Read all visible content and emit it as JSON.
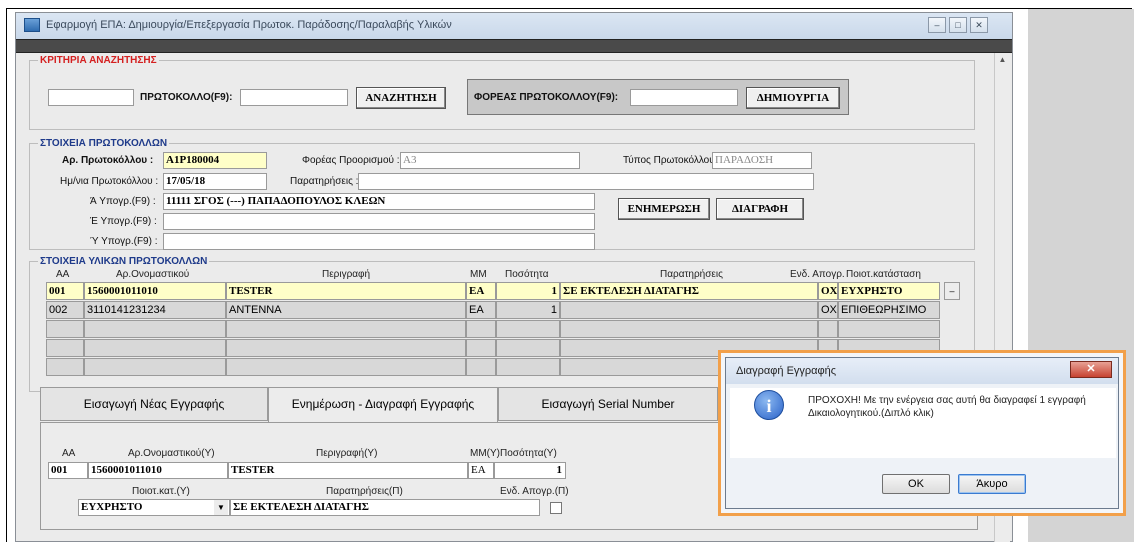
{
  "window": {
    "title": "Εφαρμογή ΕΠΑ: Δημιουργία/Επεξεργασία Πρωτοκ. Παράδοσης/Παραλαβής Υλικών",
    "min_icon": "minimize-icon",
    "max_icon": "maximize-icon",
    "close_icon": "close-icon"
  },
  "search": {
    "legend": "ΚΡΙΤΗΡΙΑ ΑΝΑΖΗΤΗΣΗΣ",
    "protocol_label": "ΠΡΩΤΟΚΟΛΛΟ(F9):",
    "search_button": "ΑΝΑΖΗΤΗΣΗ",
    "foreas_label": "ΦΟΡΕΑΣ ΠΡΩΤΟΚΟΛΛΟΥ(F9):",
    "create_button": "ΔΗΜΙΟΥΡΓΙΑ"
  },
  "protocol": {
    "legend": "ΣΤΟΙΧΕΙΑ ΠΡΩΤΟΚΟΛΛΩΝ",
    "ar_label": "Αρ. Πρωτοκόλλου :",
    "ar_value": "Α1Ρ180004",
    "foreas_label": "Φορέας Προορισμού :",
    "foreas_value": "Α3",
    "typos_label": "Τύπος Πρωτοκόλλου:",
    "typos_value": "ΠΑΡΑΔΟΣΗ",
    "date_label": "Ημ/νια Πρωτοκόλλου :",
    "date_value": "17/05/18",
    "notes_label": "Παρατηρήσεις :",
    "notes_value": "",
    "a_label": "Ά Υπογρ.(F9) :",
    "a_value": "11111 ΣΓΟΣ (---) ΠΑΠΑΔΟΠΟΥΛΟΣ ΚΛΕΩΝ",
    "b_label": "Έ Υπογρ.(F9) :",
    "b_value": "",
    "c_label": "Ύ Υπογρ.(F9) :",
    "c_value": "",
    "update_button": "ΕΝΗΜΕΡΩΣΗ",
    "delete_button": "ΔΙΑΓΡΑΦΗ"
  },
  "items": {
    "legend": "ΣΤΟΙΧΕΙΑ ΥΛΙΚΩΝ ΠΡΩΤΟΚΟΛΛΩΝ",
    "headers": [
      "ΑΑ",
      "Αρ.Ονομαστικού",
      "Περιγραφή",
      "ΜΜ",
      "Ποσότητα",
      "Παρατηρήσεις",
      "Ενδ. Απογρ.",
      "Ποιοτ.κατάσταση"
    ],
    "rows": [
      [
        "001",
        "1560001011010",
        "TESTER",
        "ΕΑ",
        "1",
        "ΣΕ ΕΚΤΕΛΕΣΗ ΔΙΑΤΑΓΗΣ",
        "ΟΧ",
        "ΕΥΧΡΗΣΤΟ"
      ],
      [
        "002",
        "3110141231234",
        "ANTENNA",
        "ΕΑ",
        "1",
        "",
        "ΟΧΙ",
        "ΕΠΙΘΕΩΡΗΣΙΜΟ"
      ]
    ]
  },
  "tabs": [
    "Εισαγωγή Νέας Εγγραφής",
    "Ενημέρωση - Διαγραφή Εγγραφής",
    "Εισαγωγή Serial Number"
  ],
  "detail": {
    "headers": [
      "ΑΑ",
      "Αρ.Ονομαστικού(Υ)",
      "Περιγραφή(Υ)",
      "ΜΜ(Υ)",
      "Ποσότητα(Υ)"
    ],
    "aa": "001",
    "onomastikou": "1560001011010",
    "perigrafi": "TESTER",
    "mm": "ΕΑ",
    "posotita": "1",
    "poiot_label": "Ποιοτ.κατ.(Υ)",
    "notes_label": "Παρατηρήσεις(Π)",
    "end_label": "Ενδ. Απογρ.(Π)",
    "poiot_value": "ΕΥΧΡΗΣΤΟ",
    "notes_value": "ΣΕ ΕΚΤΕΛΕΣΗ ΔΙΑΤΑΓΗΣ"
  },
  "dialog": {
    "title": "Διαγραφή Εγγραφής",
    "message": "ΠΡΟΧΟΧΗ! Με την ενέργεια σας αυτή θα διαγραφεί 1 εγγραφή Δικαιολογητικού.(Διπλό κλικ)",
    "ok_label": "OK",
    "cancel_label": "Άκυρο",
    "icon": "info-icon",
    "highlight_color": "#f2a04a"
  }
}
